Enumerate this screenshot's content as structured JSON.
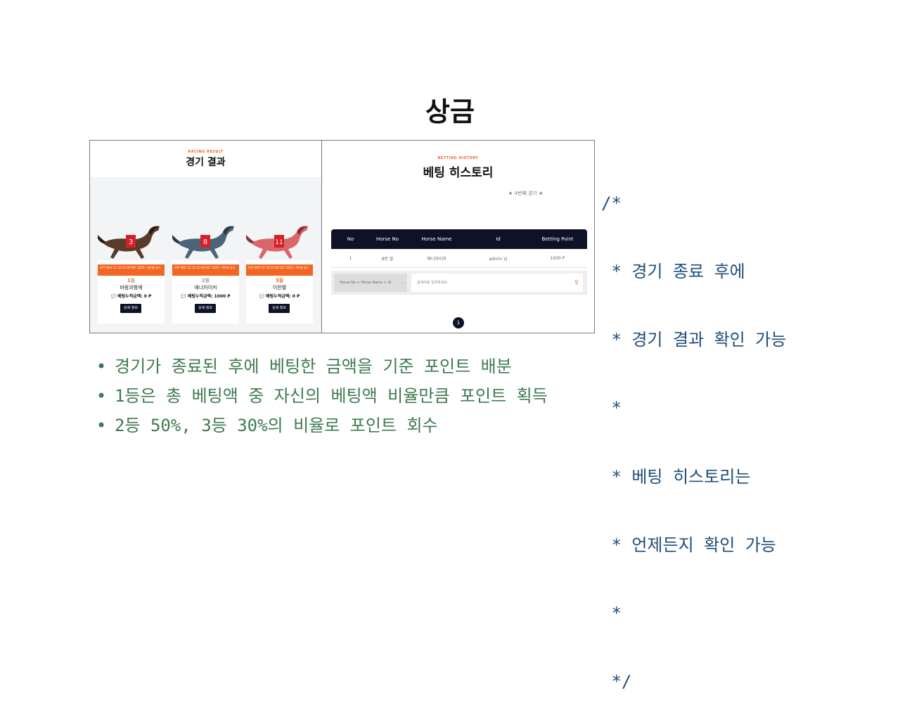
{
  "slide": {
    "title": "상금"
  },
  "left_screen": {
    "eyebrow": "RACING RESULT",
    "title": "경기 결과",
    "cards": [
      {
        "saddle": "3",
        "date": "SAT NOV 21 22:15:00 KST 2020 / 4번째 경기",
        "rank_num": "1",
        "rank_label": "등",
        "name": "바람과함께",
        "bet_label": "베팅누적금액: 0 P",
        "button": "상세 정보",
        "coat_color": "#5a3a28",
        "saddle_color": "#d61f26"
      },
      {
        "saddle": "8",
        "date": "SAT NOV 21 22:15:00 KST 2020 / 4번째 경기",
        "rank_num": "2",
        "rank_label": "등",
        "name": "에너자이저",
        "bet_label": "베팅누적금액: 1000 P",
        "button": "상세 정보",
        "coat_color": "#4b6478",
        "saddle_color": "#d61f26"
      },
      {
        "saddle": "11",
        "date": "SAT NOV 21 22:15:00 KST 2020 / 4번째 경기",
        "rank_num": "3",
        "rank_label": "등",
        "name": "이찬별",
        "bet_label": "베팅누적금액: 0 P",
        "button": "상세 정보",
        "coat_color": "#d9666a",
        "saddle_color": "#d61f26"
      }
    ]
  },
  "right_screen": {
    "eyebrow": "BETTING HISTORY",
    "title": "베팅 히스토리",
    "round": "★ 4번째 경기 ★",
    "columns": [
      "No",
      "Horse No",
      "Horse Name",
      "Id",
      "Betting Point"
    ],
    "rows": [
      [
        "1",
        "8번 말",
        "에너자이저",
        "admin 님",
        "1000 P"
      ]
    ],
    "search_select": "Horse No + Horse Name + Id",
    "search_placeholder": "검색어를 입력하세요",
    "page": "1"
  },
  "comment_lines": [
    "/*",
    " * 경기 종료 후에",
    " * 경기 결과 확인 가능",
    " *",
    " * 베팅 히스토리는",
    " * 언제든지 확인 가능",
    " *",
    " */"
  ],
  "bullets": [
    "경기가 종료된 후에 베팅한 금액을 기준 포인트 배분",
    "1등은 총 베팅액 중 자신의 베팅액 비율만큼 포인트 획득",
    "2등 50%, 3등 30%의 비율로 포인트 회수"
  ],
  "colors": {
    "comment": "#1f4e79",
    "bullet": "#3d7a4f",
    "accent": "#f26522",
    "navy": "#0d1226"
  }
}
